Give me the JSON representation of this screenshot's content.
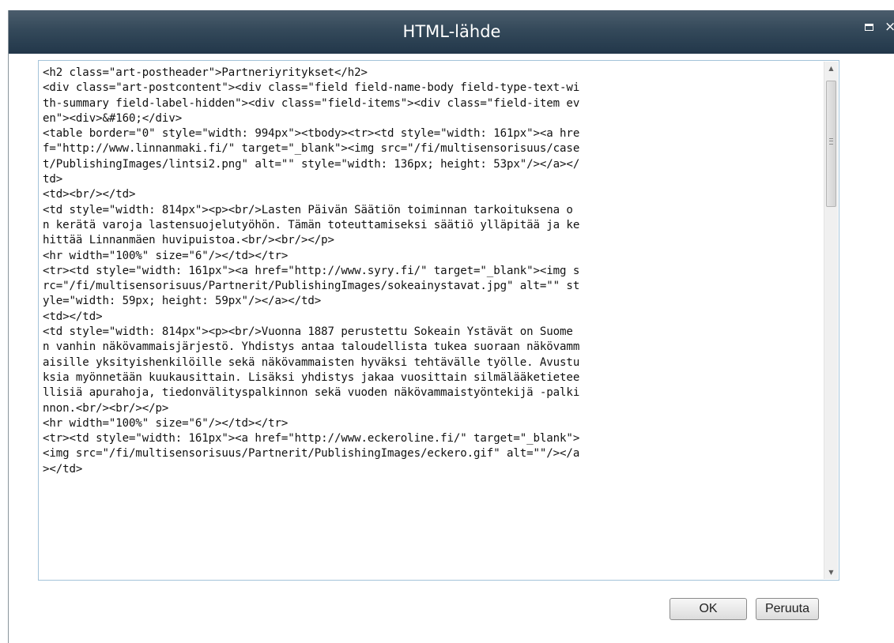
{
  "dialog": {
    "title": "HTML-lähde",
    "maximize_icon": "maximize-icon",
    "close_symbol": "×"
  },
  "editor": {
    "lines": [
      "<h2 class=\"art-postheader\">Partneriyritykset</h2>",
      "<div class=\"art-postcontent\"><div class=\"field field-name-body field-type-text-wi",
      "th-summary field-label-hidden\"><div class=\"field-items\"><div class=\"field-item ev",
      "en\"><div>&#160;</div>",
      "<table border=\"0\" style=\"width: 994px\"><tbody><tr><td style=\"width: 161px\"><a hre",
      "f=\"http://www.linnanmaki.fi/\" target=\"_blank\"><img src=\"/fi/multisensorisuus/case",
      "t/PublishingImages/lintsi2.png\" alt=\"\" style=\"width: 136px; height: 53px\"/></a></",
      "td>",
      "<td><br/></td>",
      "<td style=\"width: 814px\"><p><br/>Lasten Päivän Säätiön toiminnan tarkoituksena o",
      "n kerätä varoja lastensuojelutyöhön. Tämän toteuttamiseksi säätiö ylläpitää ja ke",
      "hittää Linnanmäen huvipuistoa.<br/><br/></p>",
      "<hr width=\"100%\" size=\"6\"/></td></tr>",
      "<tr><td style=\"width: 161px\"><a href=\"http://www.syry.fi/\" target=\"_blank\"><img s",
      "rc=\"/fi/multisensorisuus/Partnerit/PublishingImages/sokeainystavat.jpg\" alt=\"\" st",
      "yle=\"width: 59px; height: 59px\"/></a></td>",
      "<td></td>",
      "<td style=\"width: 814px\"><p><br/>Vuonna 1887 perustettu Sokeain Ystävät on Suome",
      "n vanhin näkövammaisjärjestö. Yhdistys antaa taloudellista tukea suoraan näkövamm",
      "aisille yksityishenkilöille sekä näkövammaisten hyväksi tehtävälle työlle. Avustu",
      "ksia myönnetään kuukausittain. Lisäksi yhdistys jakaa vuosittain silmälääketietee",
      "llisiä apurahoja, tiedonvälityspalkinnon sekä vuoden näkövammaistyöntekijä -palki",
      "nnon.<br/><br/></p>",
      "<hr width=\"100%\" size=\"6\"/></td></tr>",
      "<tr><td style=\"width: 161px\"><a href=\"http://www.eckeroline.fi/\" target=\"_blank\">",
      "<img src=\"/fi/multisensorisuus/Partnerit/PublishingImages/eckero.gif\" alt=\"\"/></a",
      "></td>"
    ],
    "scroll_up_icon": "scroll-up-arrow-icon",
    "scroll_down_icon": "scroll-down-arrow-icon"
  },
  "buttons": {
    "ok_label": "OK",
    "cancel_label": "Peruuta"
  }
}
